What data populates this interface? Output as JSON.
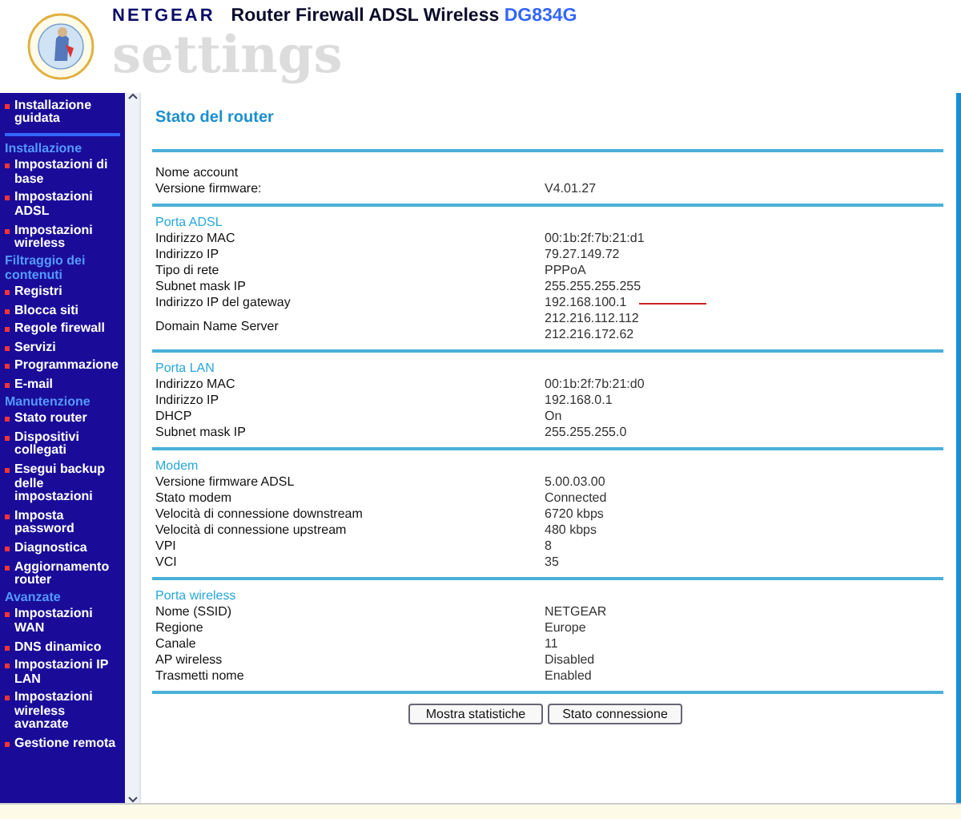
{
  "header": {
    "brand": "NETGEAR",
    "title": "Router Firewall ADSL Wireless",
    "model": "DG834G",
    "subtitle": "settings"
  },
  "sidebar": {
    "items": [
      {
        "kind": "item",
        "label": "Installazione guidata"
      },
      {
        "kind": "divider"
      },
      {
        "kind": "heading",
        "label": "Installazione"
      },
      {
        "kind": "item",
        "label": "Impostazioni di base"
      },
      {
        "kind": "item",
        "label": "Impostazioni ADSL"
      },
      {
        "kind": "item",
        "label": "Impostazioni wireless"
      },
      {
        "kind": "heading",
        "label": "Filtraggio dei contenuti"
      },
      {
        "kind": "item",
        "label": "Registri"
      },
      {
        "kind": "item",
        "label": "Blocca siti"
      },
      {
        "kind": "item",
        "label": "Regole firewall"
      },
      {
        "kind": "item",
        "label": "Servizi"
      },
      {
        "kind": "item",
        "label": "Programmazione"
      },
      {
        "kind": "item",
        "label": "E-mail"
      },
      {
        "kind": "heading",
        "label": "Manutenzione"
      },
      {
        "kind": "item",
        "label": "Stato router"
      },
      {
        "kind": "item",
        "label": "Dispositivi collegati"
      },
      {
        "kind": "item",
        "label": "Esegui backup delle impostazioni"
      },
      {
        "kind": "item",
        "label": "Imposta password"
      },
      {
        "kind": "item",
        "label": "Diagnostica"
      },
      {
        "kind": "item",
        "label": "Aggiornamento router"
      },
      {
        "kind": "heading",
        "label": "Avanzate"
      },
      {
        "kind": "item",
        "label": "Impostazioni WAN"
      },
      {
        "kind": "item",
        "label": "DNS dinamico"
      },
      {
        "kind": "item",
        "label": "Impostazioni IP LAN"
      },
      {
        "kind": "item",
        "label": "Impostazioni wireless avanzate"
      },
      {
        "kind": "item",
        "label": "Gestione remota"
      }
    ]
  },
  "page_title": "Stato del router",
  "sections": [
    {
      "rows": [
        {
          "label": "Nome account"
        },
        {
          "label": "Versione firmware:",
          "value": "V4.01.27"
        }
      ]
    },
    {
      "title": "Porta ADSL",
      "rows": [
        {
          "label": "Indirizzo MAC",
          "value": "00:1b:2f:7b:21:d1"
        },
        {
          "label": "Indirizzo IP",
          "value": "79.27.149.72"
        },
        {
          "label": "Tipo di rete",
          "value": "PPPoA"
        },
        {
          "label": "Subnet mask IP",
          "value": "255.255.255.255"
        },
        {
          "label": "Indirizzo IP del gateway",
          "value": "192.168.100.1",
          "marked": true
        },
        {
          "label": "Domain Name Server",
          "value": "212.216.112.112",
          "value2": "212.216.172.62"
        }
      ]
    },
    {
      "title": "Porta LAN",
      "rows": [
        {
          "label": "Indirizzo MAC",
          "value": "00:1b:2f:7b:21:d0"
        },
        {
          "label": "Indirizzo IP",
          "value": "192.168.0.1"
        },
        {
          "label": "DHCP",
          "value": "On"
        },
        {
          "label": "Subnet mask IP",
          "value": "255.255.255.0"
        }
      ]
    },
    {
      "title": "Modem",
      "rows": [
        {
          "label": "Versione firmware ADSL",
          "value": "5.00.03.00"
        },
        {
          "label": "Stato modem",
          "value": "Connected"
        },
        {
          "label": "Velocità di connessione downstream",
          "value": "6720 kbps"
        },
        {
          "label": "Velocità di connessione upstream",
          "value": "480 kbps"
        },
        {
          "label": "VPI",
          "value": "8"
        },
        {
          "label": "VCI",
          "value": "35"
        }
      ]
    },
    {
      "title": "Porta wireless",
      "rows": [
        {
          "label": "Nome (SSID)",
          "value": "NETGEAR"
        },
        {
          "label": "Regione",
          "value": "Europe"
        },
        {
          "label": "Canale",
          "value": "11"
        },
        {
          "label": "AP wireless",
          "value": "Disabled"
        },
        {
          "label": "Trasmetti nome",
          "value": "Enabled"
        }
      ]
    }
  ],
  "buttons": [
    "Mostra statistiche",
    "Stato connessione"
  ]
}
